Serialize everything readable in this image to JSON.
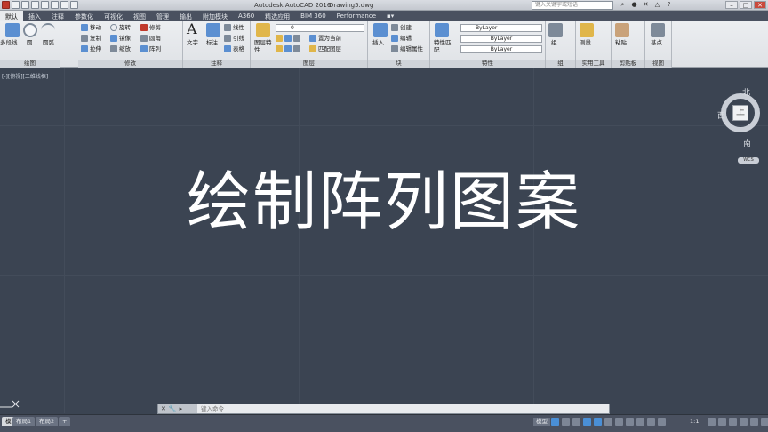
{
  "titlebar": {
    "app_title": "Autodesk AutoCAD 2016",
    "file_name": "Drawing5.dwg",
    "search_placeholder": "键入关键字或短语"
  },
  "tabs": [
    {
      "label": "默认",
      "active": true
    },
    {
      "label": "插入"
    },
    {
      "label": "注释"
    },
    {
      "label": "参数化"
    },
    {
      "label": "可视化"
    },
    {
      "label": "视图"
    },
    {
      "label": "管理"
    },
    {
      "label": "输出"
    },
    {
      "label": "附加模块"
    },
    {
      "label": "A360"
    },
    {
      "label": "精选应用"
    },
    {
      "label": "BIM 360"
    },
    {
      "label": "Performance"
    }
  ],
  "ribbon": {
    "draw": {
      "title": "绘图",
      "polyline": "多段线",
      "circle": "圆",
      "arc": "圆弧"
    },
    "modify": {
      "title": "修改",
      "move": "移动",
      "rotate": "旋转",
      "trim": "修剪",
      "copy": "复制",
      "mirror": "镜像",
      "fillet": "圆角",
      "stretch": "拉伸",
      "scale": "缩放",
      "array": "阵列"
    },
    "annotation": {
      "title": "注释",
      "text": "文字",
      "dimension": "标注",
      "linear": "线性",
      "leader": "引线",
      "table": "表格"
    },
    "layers": {
      "title": "图层",
      "layer_properties": "图层特性",
      "current_layer": "0",
      "make_current": "置为当前",
      "match_layer": "匹配图层"
    },
    "block": {
      "title": "块",
      "insert": "插入",
      "create": "创建",
      "edit": "编辑",
      "edit_attributes": "编辑属性"
    },
    "properties": {
      "title": "特性",
      "match_properties": "特性匹配",
      "color": "ByLayer",
      "linetype": "ByLayer",
      "lineweight": "ByLayer"
    },
    "groups": {
      "title": "组",
      "group": "组"
    },
    "utilities": {
      "title": "实用工具",
      "measure": "测量"
    },
    "clipboard": {
      "title": "剪贴板",
      "paste": "粘贴"
    },
    "view": {
      "title": "视图",
      "base": "基点"
    }
  },
  "viewport": {
    "label": "[-][俯视][二维线框]",
    "overlay_title": "绘制阵列图案",
    "viewcube": {
      "north": "北",
      "south": "南",
      "west": "西",
      "top": "上",
      "wcs": "WCS"
    }
  },
  "commandline": {
    "placeholder": "键入命令"
  },
  "statusbar": {
    "layout_tabs": [
      "模型",
      "布局1",
      "布局2"
    ],
    "model_label": "模型",
    "scale": "1:1"
  }
}
